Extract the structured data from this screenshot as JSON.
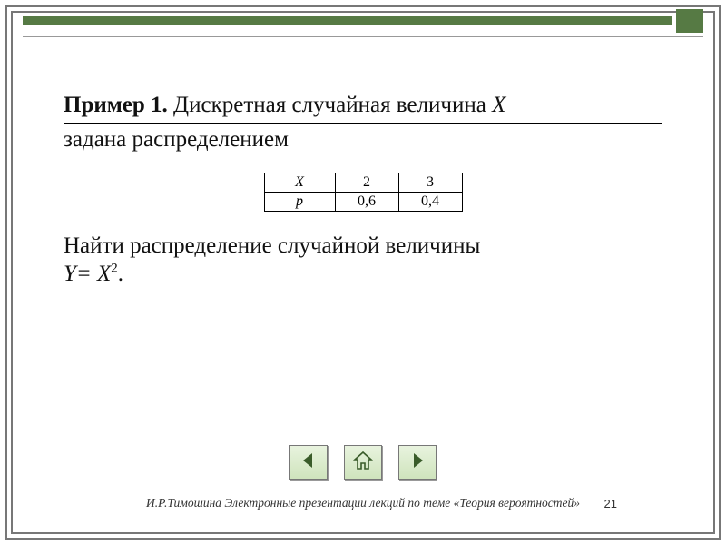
{
  "colors": {
    "accent": "#567a44"
  },
  "heading": {
    "bold": "Пример 1.",
    "line1_rest": " Дискретная случайная величина ",
    "line1_var": "Х",
    "line2": "задана распределением"
  },
  "table": {
    "row_labels": [
      "X",
      "p"
    ],
    "rows": [
      [
        "2",
        "3"
      ],
      [
        "0,6",
        "0,4"
      ]
    ]
  },
  "body": {
    "line1": "Найти распределение случайной величины",
    "line2_pre": "Y= X",
    "line2_sup": "2",
    "line2_post": "."
  },
  "nav": {
    "prev_icon": "arrow-left-icon",
    "home_icon": "home-icon",
    "next_icon": "arrow-right-icon"
  },
  "footer": "И.Р.Тимошина Электронные презентации лекций по теме «Теория вероятностей»",
  "page_number": "21"
}
